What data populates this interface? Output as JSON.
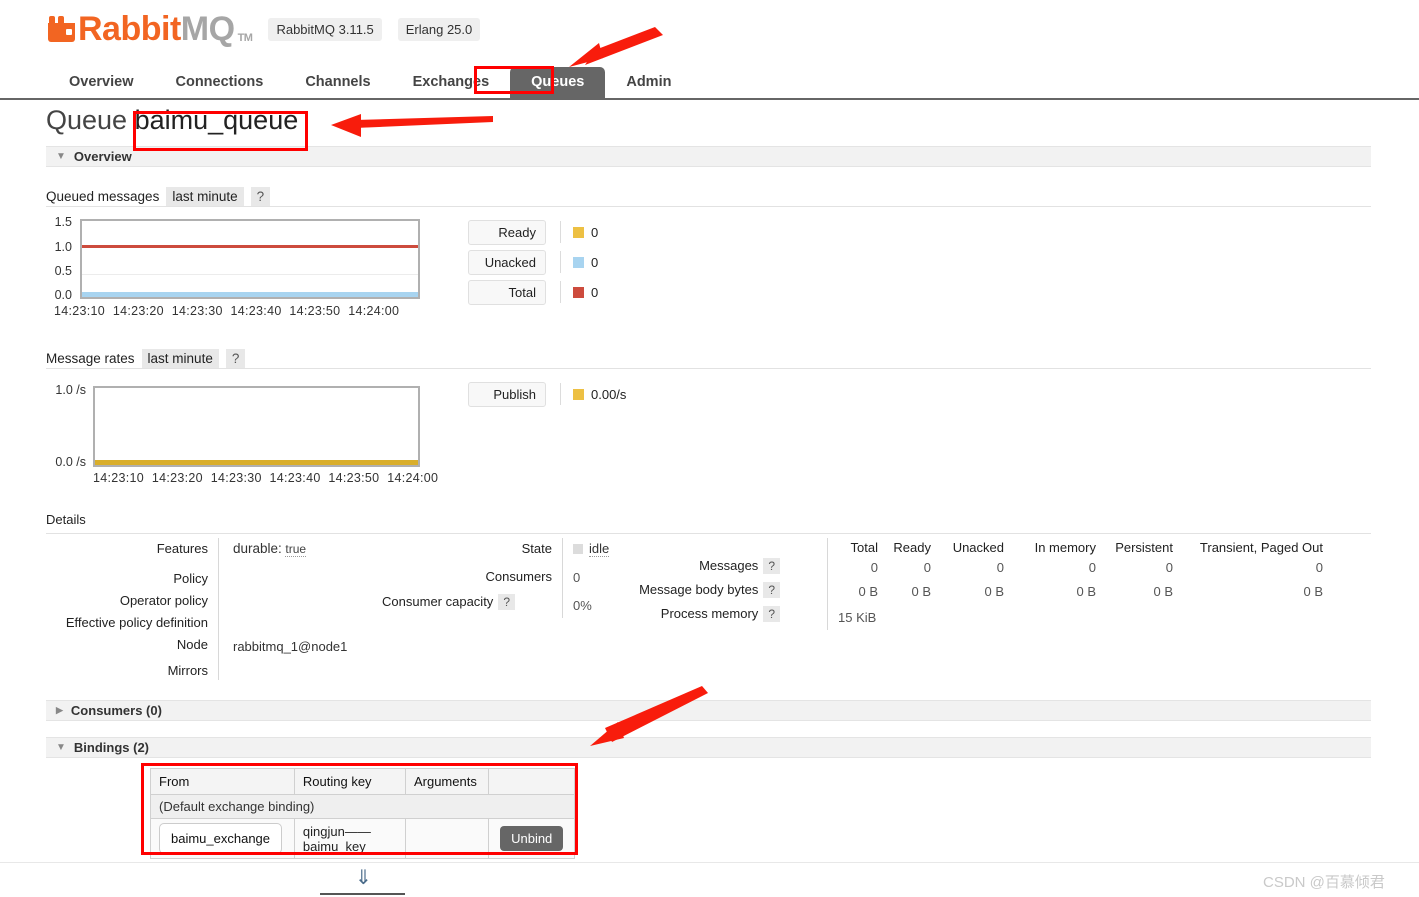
{
  "brand": {
    "name_rabbit": "Rabbit",
    "name_mq": "MQ",
    "tm": "TM",
    "version_rabbitmq": "RabbitMQ 3.11.5",
    "version_erlang": "Erlang 25.0",
    "accent_color": "#f26522",
    "logo_gray": "#a6a6a6"
  },
  "tabs": [
    {
      "label": "Overview",
      "active": false
    },
    {
      "label": "Connections",
      "active": false
    },
    {
      "label": "Channels",
      "active": false
    },
    {
      "label": "Exchanges",
      "active": false
    },
    {
      "label": "Queues",
      "active": true
    },
    {
      "label": "Admin",
      "active": false
    }
  ],
  "page": {
    "title_prefix": "Queue",
    "queue_name": "baimu_queue",
    "overview_section": "Overview",
    "details_heading": "Details",
    "consumers_section": "Consumers (0)",
    "bindings_section": "Bindings (2)"
  },
  "queued_messages": {
    "label": "Queued messages",
    "period": "last minute",
    "help": "?"
  },
  "message_rates": {
    "label": "Message rates",
    "period": "last minute",
    "help": "?"
  },
  "chart_data": [
    {
      "type": "line",
      "title": "Queued messages",
      "subtitle": "last minute",
      "xlabel": "",
      "ylabel": "",
      "ylim": [
        0.0,
        1.5
      ],
      "yticks": [
        "1.5",
        "1.0",
        "0.5",
        "0.0"
      ],
      "xticks": [
        "14:23:10",
        "14:23:20",
        "14:23:30",
        "14:23:40",
        "14:23:50",
        "14:24:00"
      ],
      "grid": true,
      "legend_position": "right",
      "series": [
        {
          "name": "Ready",
          "color": "#edc043",
          "value": "0",
          "values": [
            0,
            0,
            0,
            0,
            0,
            0
          ]
        },
        {
          "name": "Unacked",
          "color": "#a8d4f0",
          "value": "0",
          "values": [
            0,
            0,
            0,
            0,
            0,
            0
          ]
        },
        {
          "name": "Total",
          "color": "#cd4b3d",
          "value": "0",
          "values": [
            1,
            1,
            1,
            1,
            1,
            1
          ]
        }
      ]
    },
    {
      "type": "line",
      "title": "Message rates",
      "subtitle": "last minute",
      "xlabel": "",
      "ylabel": "",
      "ylim": [
        0.0,
        1.0
      ],
      "yticks": [
        "1.0 /s",
        "0.0 /s"
      ],
      "xticks": [
        "14:23:10",
        "14:23:20",
        "14:23:30",
        "14:23:40",
        "14:23:50",
        "14:24:00"
      ],
      "grid": false,
      "legend_position": "right",
      "series": [
        {
          "name": "Publish",
          "color": "#edc043",
          "value": "0.00/s",
          "values": [
            0,
            0,
            0,
            0,
            0,
            0
          ]
        }
      ]
    }
  ],
  "details": {
    "left_labels": [
      "Features",
      "Policy",
      "Operator policy",
      "Effective policy definition",
      "Node",
      "Mirrors"
    ],
    "features_key": "durable:",
    "features_value": "true",
    "node_value": "rabbitmq_1@node1",
    "mid": {
      "state_label": "State",
      "state_value": "idle",
      "consumers_label": "Consumers",
      "consumers_value": "0",
      "capacity_label": "Consumer capacity",
      "capacity_help": "?",
      "capacity_value": "0%"
    },
    "table": {
      "columns": [
        "Total",
        "Ready",
        "Unacked",
        "In memory",
        "Persistent",
        "Transient, Paged Out"
      ],
      "rows": [
        {
          "label": "Messages",
          "help": "?",
          "values": [
            "0",
            "0",
            "0",
            "0",
            "0",
            "0"
          ]
        },
        {
          "label": "Message body bytes",
          "help": "?",
          "values": [
            "0 B",
            "0 B",
            "0 B",
            "0 B",
            "0 B",
            "0 B"
          ]
        },
        {
          "label": "Process memory",
          "help": "?",
          "values": [
            "15 KiB",
            "",
            "",
            "",
            "",
            ""
          ]
        }
      ]
    }
  },
  "bindings": {
    "columns": [
      "From",
      "Routing key",
      "Arguments",
      ""
    ],
    "default_row": "(Default exchange binding)",
    "rows": [
      {
        "from": "baimu_exchange",
        "routing_key": "qingjun——baimu_key",
        "arguments": "",
        "action": "Unbind"
      }
    ]
  },
  "footer": {
    "down_arrow": "⇓",
    "watermark": "CSDN @百慕倾君"
  },
  "annotations": {
    "color": "#ff0000",
    "boxes": [
      "queues-tab",
      "queue-name",
      "bindings-table"
    ],
    "arrows": [
      "to-queues-tab",
      "to-queue-name",
      "to-bindings"
    ]
  }
}
